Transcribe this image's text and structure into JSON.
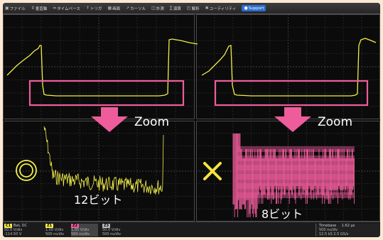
{
  "menu": [
    {
      "icon": "file-icon",
      "label": "ファイル"
    },
    {
      "icon": "vertical-icon",
      "label": "垂直軸"
    },
    {
      "icon": "timebase-icon",
      "label": "タイムベース"
    },
    {
      "icon": "trigger-icon",
      "label": "トリガ"
    },
    {
      "icon": "display-icon",
      "label": "画面"
    },
    {
      "icon": "cursor-icon",
      "label": "カーソル"
    },
    {
      "icon": "measure-icon",
      "label": "計測"
    },
    {
      "icon": "math-icon",
      "label": "演算"
    },
    {
      "icon": "analysis-icon",
      "label": "解析"
    },
    {
      "icon": "utility-icon",
      "label": "ユーティリティ"
    },
    {
      "icon": "support-icon",
      "label": "Support"
    }
  ],
  "annotations": {
    "zoom_left": "Zoom",
    "zoom_right": "Zoom",
    "bits_left": "12ビット",
    "bits_right": "8ビット"
  },
  "status": {
    "ch_labels": [
      "C1",
      "Z1",
      "Z2",
      "Z3"
    ],
    "ch1": {
      "name": "BwL DC",
      "line1": "50.0 V/div",
      "line2": "-114.50 V"
    },
    "ch2": {
      "line1": "1.00 V/div",
      "line2": "500 ns/div"
    },
    "ch3": {
      "line1": "1.00 V/div",
      "line2": "500 ns/div"
    },
    "ch4": {
      "line1": "50.0 V/div",
      "line2": "500 ns/div"
    },
    "timebase": {
      "title": "Timebase",
      "value": "1.62 μs",
      "line2": "500 ns/div",
      "line3": "12.5 kS   2.5 GS/s"
    }
  },
  "colors": {
    "trace": "#f2ee4a",
    "trace_dim": "#e6df3a",
    "highlight": "#ee5c9b",
    "grid": "#3b3b3b",
    "grid_center": "#5b5b5b"
  }
}
